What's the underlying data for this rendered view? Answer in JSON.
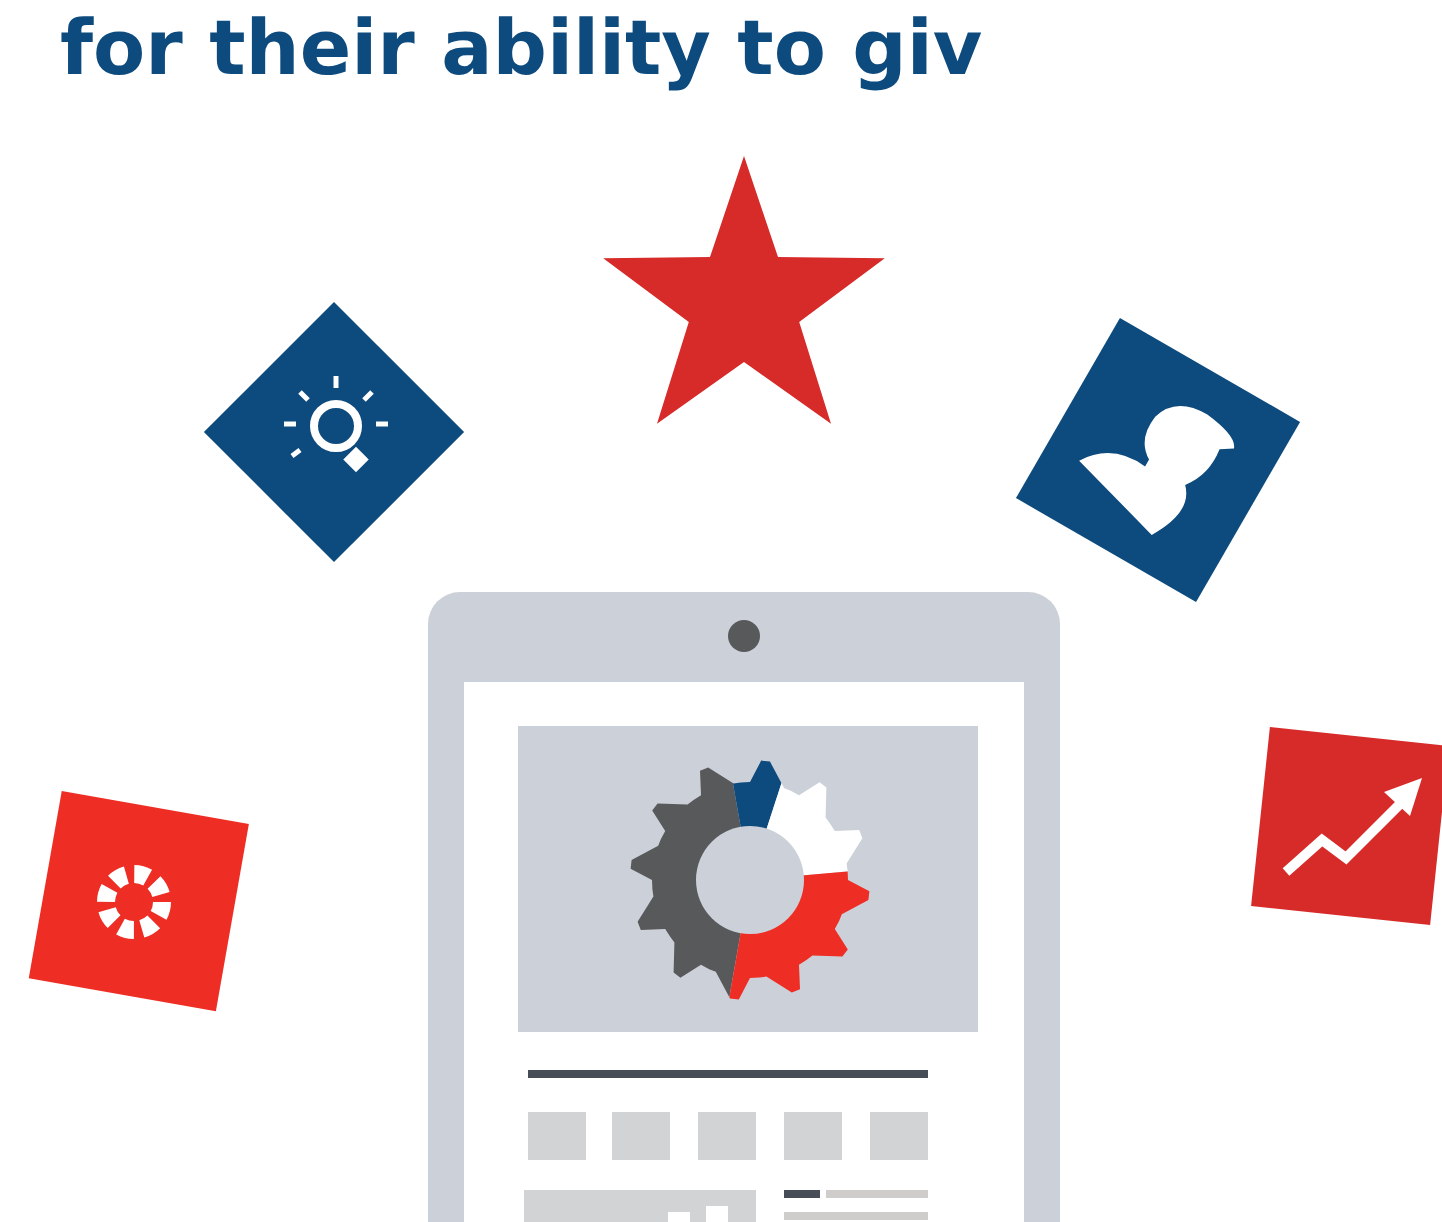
{
  "heading": "for their ability to giv"
}
